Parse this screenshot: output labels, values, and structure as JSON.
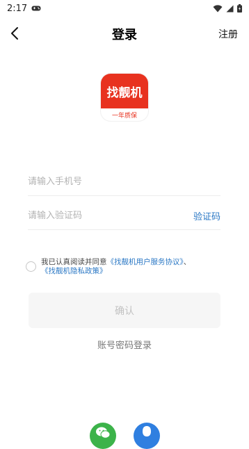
{
  "status_bar": {
    "time": "2:17"
  },
  "header": {
    "title": "登录",
    "register_label": "注册"
  },
  "logo": {
    "name": "找靓机",
    "tagline": "一年质保"
  },
  "form": {
    "phone_placeholder": "请输入手机号",
    "code_placeholder": "请输入验证码",
    "get_code_label": "验证码"
  },
  "agreement": {
    "prefix": "我已认真阅读并同意",
    "user_agreement": "《找靓机用户服务协议》",
    "separator": "、",
    "privacy_policy": "《找靓机隐私政策》"
  },
  "confirm_label": "确认",
  "password_login_label": "账号密码登录",
  "colors": {
    "brand_red": "#e8321f",
    "link_blue": "#2b78c5",
    "wechat_green": "#3cb34a",
    "qq_blue": "#2f7fe0"
  },
  "icons": [
    "back-arrow-icon",
    "wifi-icon",
    "signal-icon",
    "battery-icon",
    "gamepad-icon",
    "wechat-icon",
    "qq-icon"
  ]
}
